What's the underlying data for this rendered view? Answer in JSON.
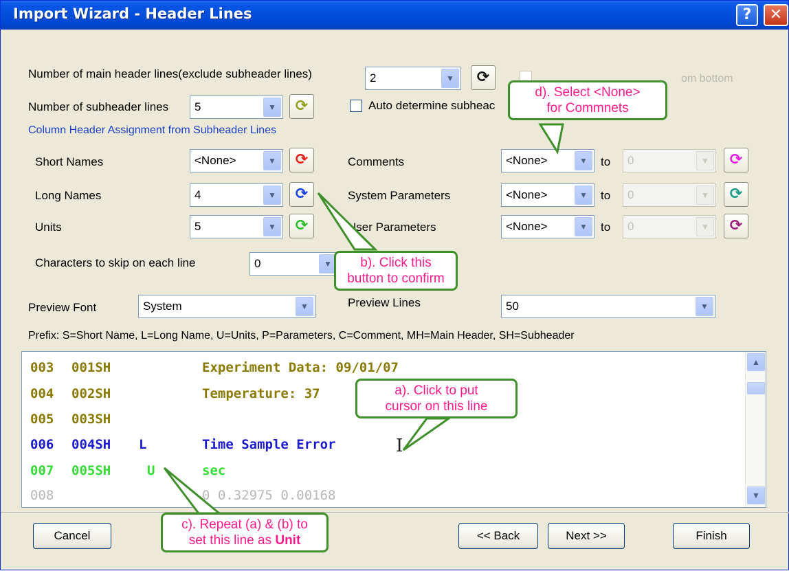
{
  "window": {
    "title": "Import Wizard - Header Lines",
    "help_glyph": "?",
    "close_glyph": "✕"
  },
  "main_header": {
    "label": "Number of main header lines(exclude subheader lines)",
    "value": "2"
  },
  "subheader": {
    "label": "Number of subheader lines",
    "value": "5"
  },
  "auto_determine": {
    "label": "Auto determine subheac",
    "checked": false
  },
  "faded_text": "om bottom",
  "section_title": "Column Header Assignment from Subheader Lines",
  "assign_left": [
    {
      "label": "Short Names",
      "value": "<None>",
      "refresh_color": "#e0201a"
    },
    {
      "label": "Long Names",
      "value": "4",
      "refresh_color": "#1a3fe0"
    },
    {
      "label": "Units",
      "value": "5",
      "refresh_color": "#2bbf2b"
    }
  ],
  "assign_right": [
    {
      "label": "Comments",
      "value": "<None>",
      "to": "to",
      "to_value": "0",
      "refresh_color": "#e020e0"
    },
    {
      "label": "System Parameters",
      "value": "<None>",
      "to": "to",
      "to_value": "0",
      "refresh_color": "#1a9a8a"
    },
    {
      "label": "User Parameters",
      "value": "<None>",
      "to": "to",
      "to_value": "0",
      "refresh_color": "#a02080"
    }
  ],
  "skip": {
    "label": "Characters to skip on each line",
    "value": "0"
  },
  "preview_font": {
    "label": "Preview Font",
    "value": "System"
  },
  "preview_lines": {
    "label": "Preview Lines",
    "value": "50"
  },
  "prefix_text": "Prefix:  S=Short Name, L=Long Name, U=Units, P=Parameters, C=Comment, MH=Main Header, SH=Subheader",
  "preview": [
    {
      "line": "003",
      "code": "001SH",
      "flag": "",
      "text": "Experiment Data: 09/01/07",
      "color": "#8a7a00"
    },
    {
      "line": "004",
      "code": "002SH",
      "flag": "",
      "text": "Temperature: 37",
      "color": "#8a7a00"
    },
    {
      "line": "005",
      "code": "003SH",
      "flag": "",
      "text": "",
      "color": "#8a7a00"
    },
    {
      "line": "006",
      "code": "004SH",
      "flag": "L",
      "text": "Time Sample Error",
      "color": "#1a1ad0"
    },
    {
      "line": "007",
      "code": "005SH",
      "flag": "U",
      "text": "sec",
      "color": "#33dd33"
    },
    {
      "line": "008",
      "code": "",
      "flag": "",
      "text": "0 0.32975 0.00168",
      "color": "#b8b8b8"
    }
  ],
  "buttons": {
    "cancel": "Cancel",
    "back": "<< Back",
    "next": "Next >>",
    "finish": "Finish"
  },
  "callouts": {
    "a_line1": "a). Click to put",
    "a_line2": "cursor on this line",
    "b_line1": "b). Click this",
    "b_line2": "button to confirm",
    "c_line1": "c). Repeat (a) & (b) to",
    "c_line2_prefix": "set this line as ",
    "c_line2_bold": "Unit",
    "d_line1": "d). Select <None>",
    "d_line2": "for Commnets"
  },
  "colors": {
    "callout_border": "#3f8f2a",
    "callout_text": "#ff1a8c",
    "title_bar": "#0350dc",
    "dialog_bg": "#ece9d8"
  },
  "icons": {
    "dropdown": "chevron-down-icon",
    "refresh": "refresh-icon",
    "cursor": "text-cursor-icon"
  }
}
